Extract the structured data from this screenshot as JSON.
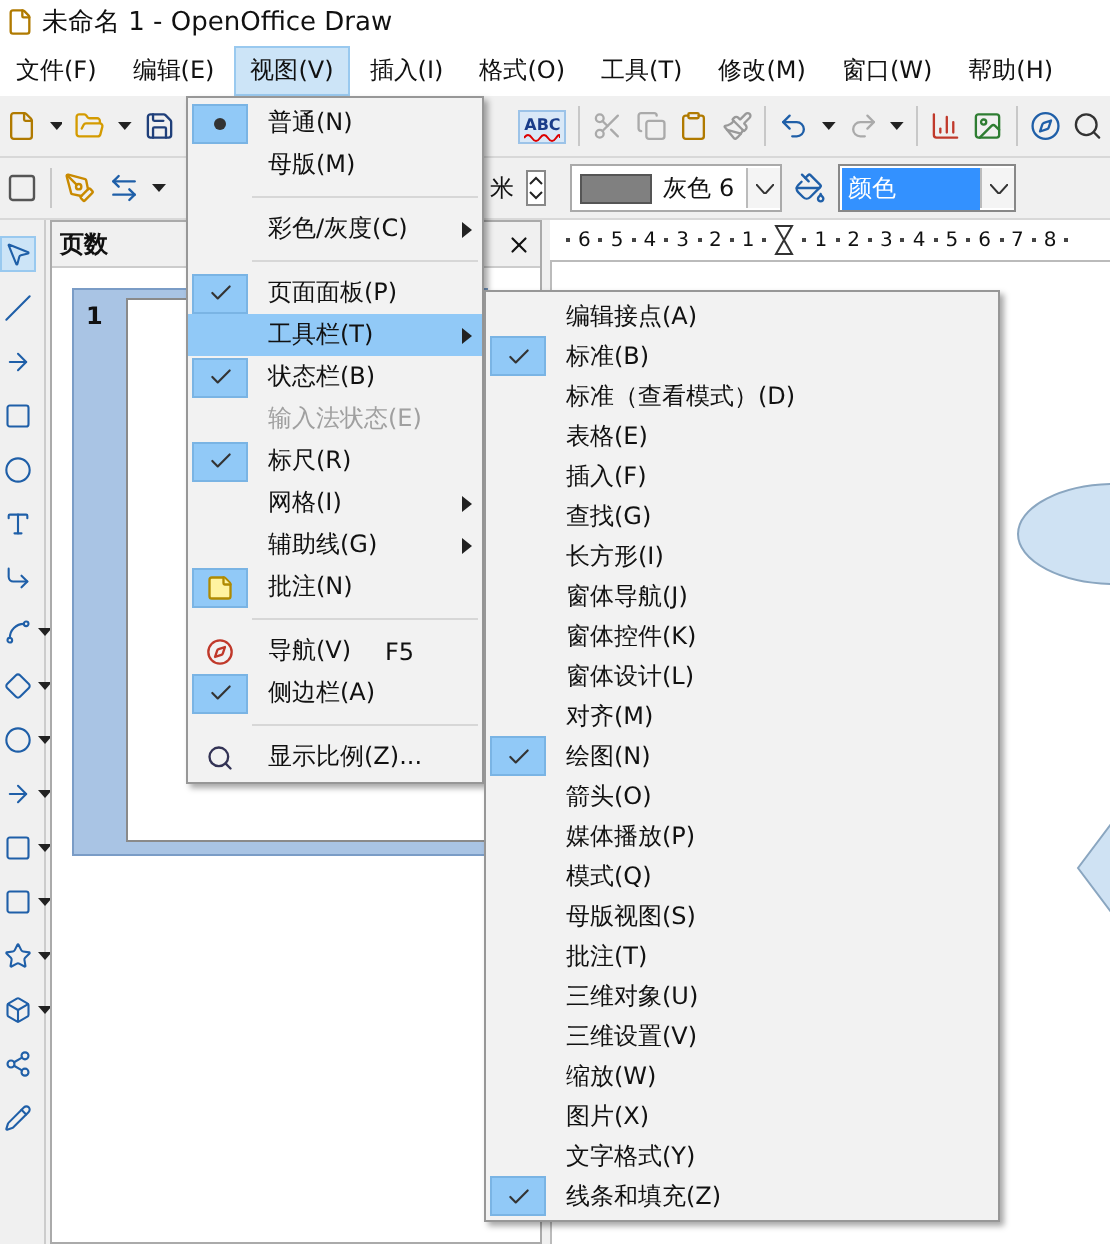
{
  "window": {
    "title": "未命名 1 - OpenOffice Draw"
  },
  "menu_bar": [
    {
      "label": "文件(F)",
      "selected": false
    },
    {
      "label": "编辑(E)",
      "selected": false
    },
    {
      "label": "视图(V)",
      "selected": true
    },
    {
      "label": "插入(I)",
      "selected": false
    },
    {
      "label": "格式(O)",
      "selected": false
    },
    {
      "label": "工具(T)",
      "selected": false
    },
    {
      "label": "修改(M)",
      "selected": false
    },
    {
      "label": "窗口(W)",
      "selected": false
    },
    {
      "label": "帮助(H)",
      "selected": false
    }
  ],
  "standard_toolbar": {
    "spellcheck_label": "ABC"
  },
  "line_toolbar": {
    "line_width_unit": "米",
    "line_color": "灰色 6",
    "area_fill": "颜色"
  },
  "pages_panel": {
    "title": "页数",
    "pages": [
      {
        "number": "1",
        "selected": true
      }
    ]
  },
  "ruler": {
    "left_labels": [
      "6",
      "5",
      "4",
      "3",
      "2",
      "1"
    ],
    "right_labels": [
      "1",
      "2",
      "3",
      "4",
      "5",
      "6",
      "7",
      "8"
    ]
  },
  "view_menu": {
    "items": [
      {
        "kind": "radio",
        "label": "普通(N)",
        "selected": true,
        "highlighted": false,
        "disabled": false
      },
      {
        "kind": "radio",
        "label": "母版(M)",
        "selected": false,
        "highlighted": false,
        "disabled": false
      },
      {
        "kind": "separator"
      },
      {
        "kind": "submenu",
        "label": "彩色/灰度(C)",
        "highlighted": false,
        "disabled": false
      },
      {
        "kind": "separator"
      },
      {
        "kind": "check",
        "label": "页面面板(P)",
        "checked": true,
        "highlighted": false,
        "disabled": false
      },
      {
        "kind": "submenu",
        "label": "工具栏(T)",
        "highlighted": true,
        "disabled": false
      },
      {
        "kind": "check",
        "label": "状态栏(B)",
        "checked": true,
        "highlighted": false,
        "disabled": false
      },
      {
        "kind": "check",
        "label": "输入法状态(E)",
        "checked": false,
        "highlighted": false,
        "disabled": true
      },
      {
        "kind": "check",
        "label": "标尺(R)",
        "checked": true,
        "highlighted": false,
        "disabled": false
      },
      {
        "kind": "submenu",
        "label": "网格(I)",
        "highlighted": false,
        "disabled": false
      },
      {
        "kind": "submenu",
        "label": "辅助线(G)",
        "highlighted": false,
        "disabled": false
      },
      {
        "kind": "icon",
        "label": "批注(N)",
        "checked": true,
        "highlighted": false,
        "disabled": false
      },
      {
        "kind": "separator"
      },
      {
        "kind": "icon",
        "label": "导航(V)",
        "shortcut": "F5",
        "checked": false,
        "highlighted": false,
        "disabled": false
      },
      {
        "kind": "check",
        "label": "侧边栏(A)",
        "checked": true,
        "highlighted": false,
        "disabled": false
      },
      {
        "kind": "separator"
      },
      {
        "kind": "icon",
        "label": "显示比例(Z)...",
        "checked": false,
        "highlighted": false,
        "disabled": false
      }
    ]
  },
  "toolbars_submenu": {
    "items": [
      {
        "label": "编辑接点(A)",
        "checked": false
      },
      {
        "label": "标准(B)",
        "checked": true
      },
      {
        "label": "标准（查看模式）(D)",
        "checked": false
      },
      {
        "label": "表格(E)",
        "checked": false
      },
      {
        "label": "插入(F)",
        "checked": false
      },
      {
        "label": "查找(G)",
        "checked": false
      },
      {
        "label": "长方形(I)",
        "checked": false
      },
      {
        "label": "窗体导航(J)",
        "checked": false
      },
      {
        "label": "窗体控件(K)",
        "checked": false
      },
      {
        "label": "窗体设计(L)",
        "checked": false
      },
      {
        "label": "对齐(M)",
        "checked": false
      },
      {
        "label": "绘图(N)",
        "checked": true
      },
      {
        "label": "箭头(O)",
        "checked": false
      },
      {
        "label": "媒体播放(P)",
        "checked": false
      },
      {
        "label": "模式(Q)",
        "checked": false
      },
      {
        "label": "母版视图(S)",
        "checked": false
      },
      {
        "label": "批注(T)",
        "checked": false
      },
      {
        "label": "三维对象(U)",
        "checked": false
      },
      {
        "label": "三维设置(V)",
        "checked": false
      },
      {
        "label": "缩放(W)",
        "checked": false
      },
      {
        "label": "图片(X)",
        "checked": false
      },
      {
        "label": "文字格式(Y)",
        "checked": false
      },
      {
        "label": "线条和填充(Z)",
        "checked": true
      }
    ]
  }
}
